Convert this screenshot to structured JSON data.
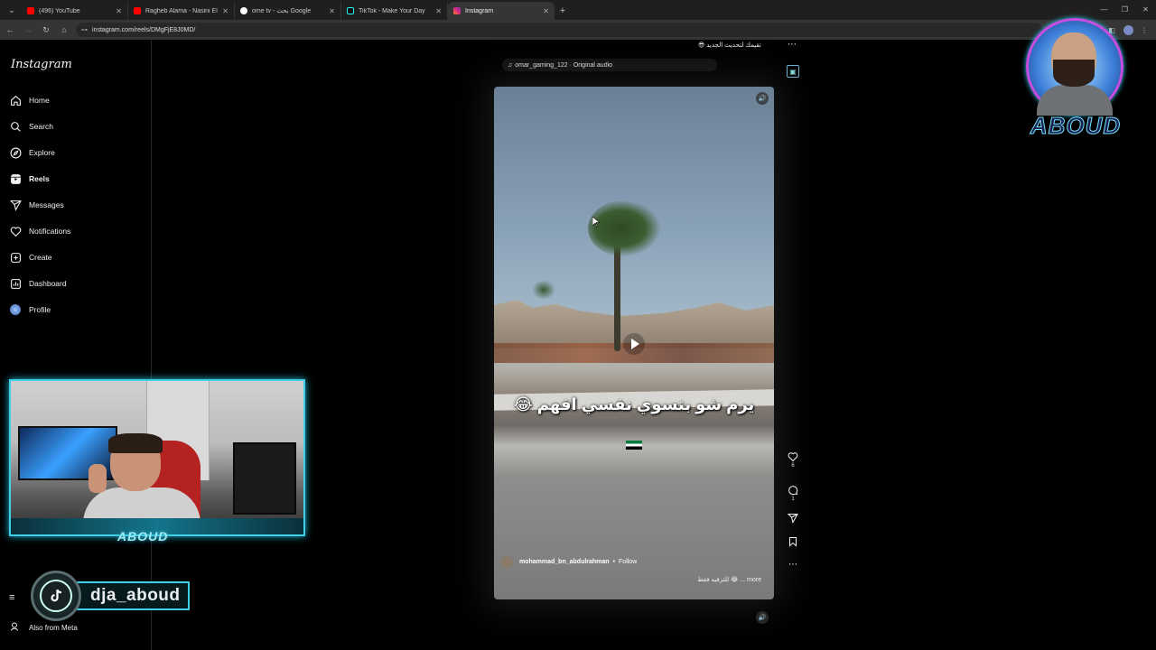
{
  "browser": {
    "tabs": [
      {
        "title": "(496) YouTube",
        "color": "#ff0000",
        "active": false
      },
      {
        "title": "Ragheb Alama - Nasini El Donya",
        "color": "#ff0000",
        "active": false
      },
      {
        "title": "ome tv - بحث Google",
        "color": "#4285f4",
        "active": false
      },
      {
        "title": "TikTok - Make Your Day",
        "color": "#25f4ee",
        "active": false
      },
      {
        "title": "Instagram",
        "color": "#e1306c",
        "active": true
      }
    ],
    "url": "instagram.com/reels/DMgFjE8J0MD/"
  },
  "sidebar": {
    "logo": "Instagram",
    "items": [
      {
        "label": "Home",
        "icon": "home-icon"
      },
      {
        "label": "Search",
        "icon": "search-icon"
      },
      {
        "label": "Explore",
        "icon": "compass-icon"
      },
      {
        "label": "Reels",
        "icon": "reels-icon",
        "active": true
      },
      {
        "label": "Messages",
        "icon": "send-icon"
      },
      {
        "label": "Notifications",
        "icon": "heart-icon"
      },
      {
        "label": "Create",
        "icon": "plus-square-icon"
      },
      {
        "label": "Dashboard",
        "icon": "dashboard-icon"
      },
      {
        "label": "Profile",
        "icon": "profile-avatar"
      }
    ],
    "more_icon": "≡",
    "also_from_meta": "Also from Meta"
  },
  "stream_overlay": {
    "cam_label": "ABOUD",
    "tiktok_handle": "dja_aboud",
    "brand_word": "ABOUD"
  },
  "reel": {
    "top_caption": "😎 تقيمك لتحديث الجديد",
    "audio": "omar_gaming_122 · Original audio",
    "overlay_text": "يرم شو بتسوي نفسي افهم 😂",
    "author": "mohammad_bn_abdulrahman",
    "dot": "•",
    "follow": "Follow",
    "caption": "للترفيه فقط 😂 ... more",
    "likes": "6",
    "comments": "1"
  },
  "colors": {
    "accent_cyan": "#3fd0e6",
    "sidebar_bg": "#000000"
  }
}
